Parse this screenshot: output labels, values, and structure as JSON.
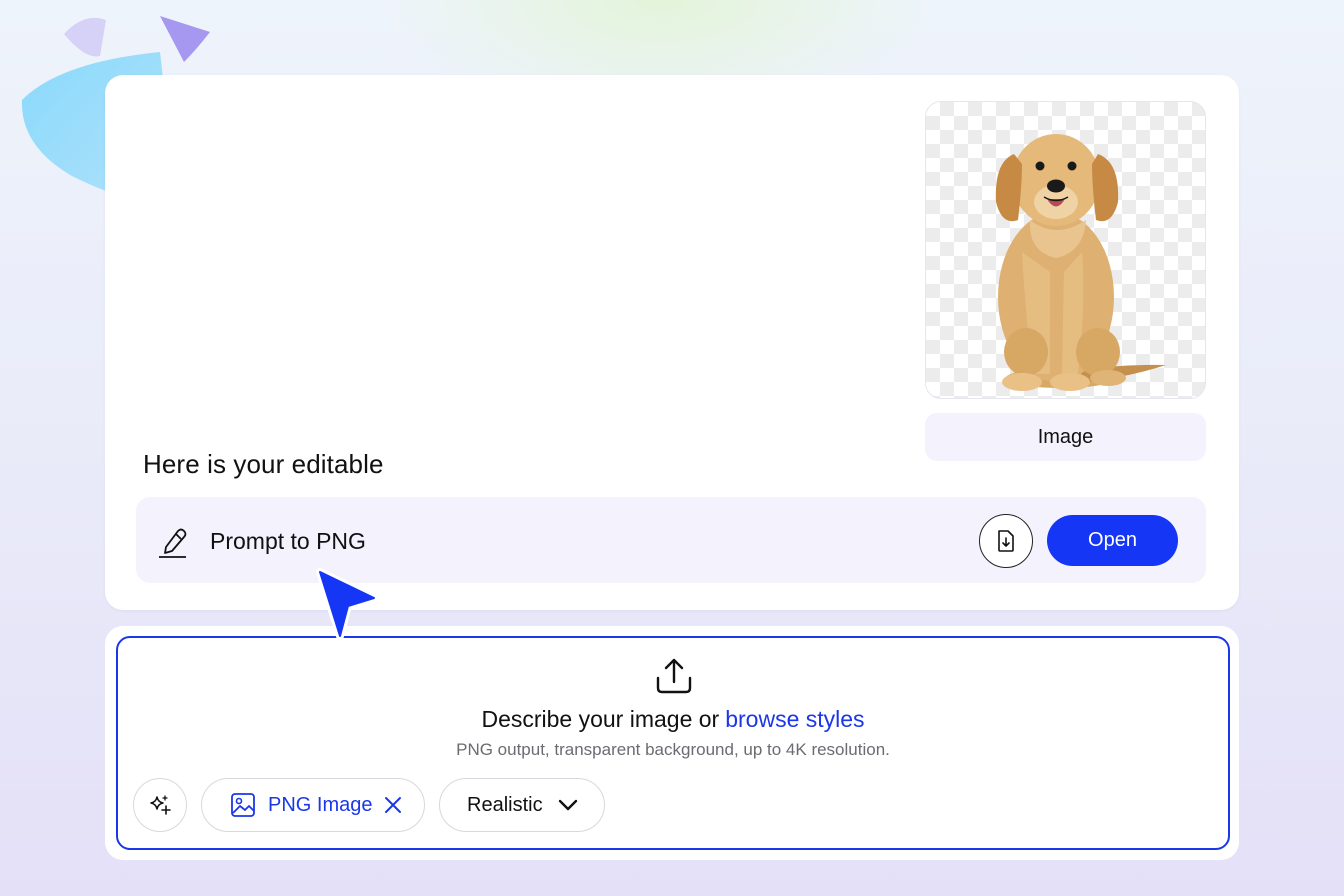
{
  "preview": {
    "caption": "Image"
  },
  "result": {
    "headline": "Here is your editable",
    "prompt_label": "Prompt to PNG",
    "open_label": "Open"
  },
  "composer": {
    "describe_text": "Describe your image or",
    "browse_link": "browse styles",
    "subtext": "PNG output, transparent background, up to 4K resolution.",
    "format_chip": "PNG Image",
    "style_select": "Realistic"
  },
  "colors": {
    "accent": "#1536F5",
    "link": "#1B37E8",
    "panel_tint": "#F3F2FD"
  },
  "icons": [
    "pencil-icon",
    "download-file-icon",
    "upload-icon",
    "sparkles-icon",
    "image-icon",
    "close-icon",
    "chevron-down-icon",
    "cursor-arrow-icon"
  ]
}
